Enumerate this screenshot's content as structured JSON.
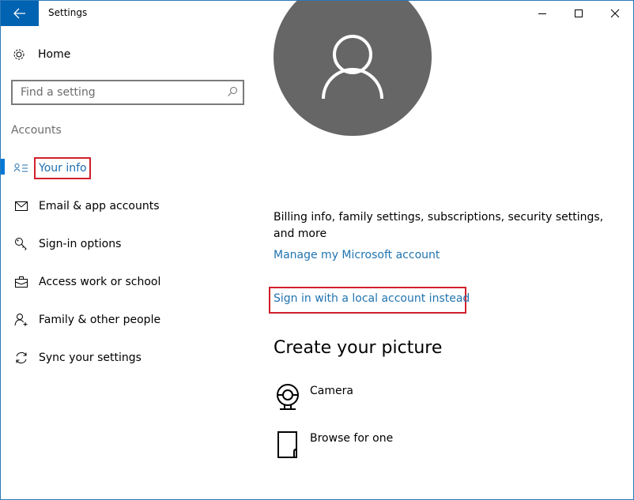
{
  "window": {
    "title": "Settings",
    "controls": [
      "minimize",
      "maximize",
      "close"
    ]
  },
  "sidebar": {
    "home_label": "Home",
    "search": {
      "placeholder": "Find a setting",
      "value": ""
    },
    "section_title": "Accounts",
    "items": [
      {
        "label": "Your info",
        "icon": "contact-info-icon",
        "active": true,
        "highlighted": true
      },
      {
        "label": "Email & app accounts",
        "icon": "mail-icon",
        "active": false
      },
      {
        "label": "Sign-in options",
        "icon": "key-icon",
        "active": false
      },
      {
        "label": "Access work or school",
        "icon": "briefcase-icon",
        "active": false
      },
      {
        "label": "Family & other people",
        "icon": "add-person-icon",
        "active": false
      },
      {
        "label": "Sync your settings",
        "icon": "sync-icon",
        "active": false
      }
    ]
  },
  "main": {
    "description": "Billing info, family settings, subscriptions, security settings, and more",
    "manage_link": "Manage my Microsoft account",
    "local_account_link": "Sign in with a local account instead",
    "create_picture_heading": "Create your picture",
    "picture_options": [
      {
        "label": "Camera",
        "icon": "camera-icon"
      },
      {
        "label": "Browse for one",
        "icon": "file-icon"
      }
    ]
  },
  "colors": {
    "accent": "#0078d7",
    "title_back_bg": "#0063b1",
    "link": "#2174b0",
    "highlight": "#d1202c",
    "avatar_bg": "#666666"
  }
}
